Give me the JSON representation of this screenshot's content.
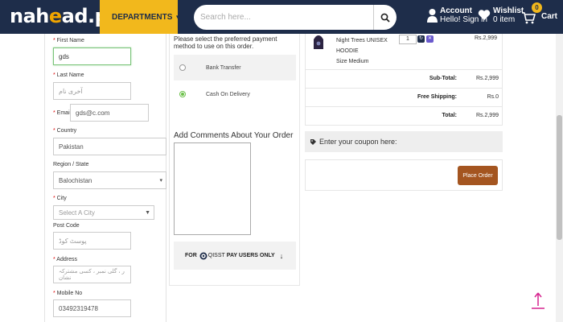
{
  "header": {
    "logo_a": "nah",
    "logo_b": "e",
    "logo_c": "ad",
    "logo_d": ".pk",
    "departments_label": "DEPARTMENTS",
    "search_placeholder": "Search here...",
    "account_title": "Account",
    "account_sub": "Hello! Sign in",
    "wishlist_title": "Wishlist",
    "wishlist_sub": "0 item",
    "cart_label": "Cart",
    "cart_count": "0"
  },
  "form": {
    "first_name_label": "First Name",
    "first_name_value": "gds",
    "last_name_label": "Last Name",
    "last_name_placeholder": "آخری نام",
    "email_label": "Email",
    "email_value": "gds@c.com",
    "country_label": "Country",
    "country_value": "Pakistan",
    "region_label": "Region / State",
    "region_value": "Balochistan",
    "city_label": "City",
    "city_placeholder": "Select A City",
    "postcode_label": "Post Code",
    "postcode_placeholder": "پوسٹ کوڈ",
    "address_label": "Address",
    "address_placeholder": "ر ، گلی نمبر ، کسی مشترکہ نشان",
    "mobile_label": "Mobile No",
    "mobile_value": "03492319478"
  },
  "payment": {
    "note": "Please select the preferred payment method to use on this order.",
    "option_bank": "Bank Transfer",
    "option_cod": "Cash On Delivery",
    "selected": "Cash On Delivery",
    "comments_title": "Add Comments About Your Order",
    "qisst_label_a": "FOR",
    "qisst_label_b": "QISST",
    "qisst_label_c": "PAY USERS ONLY"
  },
  "order": {
    "product_name": "Night Trees UNISEX HOODIE",
    "product_size": "Size Medium",
    "quantity": "1",
    "product_price": "Rs.2,999",
    "subtotal_label": "Sub-Total:",
    "subtotal_value": "Rs.2,999",
    "shipping_label": "Free Shipping:",
    "shipping_value": "Rs.0",
    "total_label": "Total:",
    "total_value": "Rs.2,999",
    "coupon_text": "Enter your coupon here:",
    "place_order": "Place Order"
  },
  "colors": {
    "header_bg": "#1e2d4a",
    "accent_yellow": "#f2b81c",
    "place_order_bg": "#a45520",
    "radio_selected": "#6cc04a",
    "scroll_top_arrow": "#d6248f"
  }
}
